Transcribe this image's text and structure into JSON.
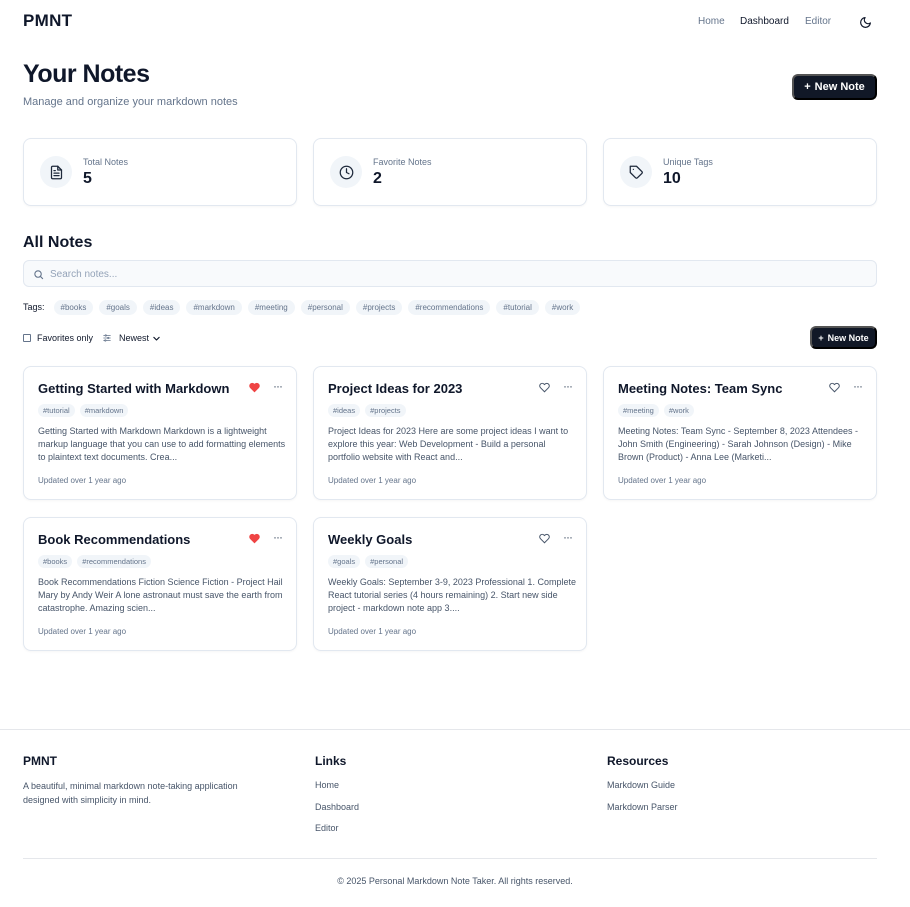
{
  "header": {
    "logo": "PMNT",
    "nav": [
      "Home",
      "Dashboard",
      "Editor"
    ]
  },
  "page": {
    "title": "Your Notes",
    "subtitle": "Manage and organize your markdown notes",
    "new_note_label": "New Note"
  },
  "stats": [
    {
      "label": "Total Notes",
      "value": "5",
      "icon": "file-text-icon"
    },
    {
      "label": "Favorite Notes",
      "value": "2",
      "icon": "clock-icon"
    },
    {
      "label": "Unique Tags",
      "value": "10",
      "icon": "tag-icon"
    }
  ],
  "all_notes": {
    "title": "All Notes",
    "search_placeholder": "Search notes...",
    "tags_label": "Tags:",
    "tags": [
      "#books",
      "#goals",
      "#ideas",
      "#markdown",
      "#meeting",
      "#personal",
      "#projects",
      "#recommendations",
      "#tutorial",
      "#work"
    ],
    "favorites_only_label": "Favorites only",
    "sort_label": "Newest",
    "new_note_label": "New Note"
  },
  "notes": [
    {
      "title": "Getting Started with Markdown",
      "favorite": true,
      "tags": [
        "#tutorial",
        "#markdown"
      ],
      "excerpt": "Getting Started with Markdown Markdown is a lightweight markup language that you can use to add formatting elements to plaintext text documents. Crea...",
      "updated": "Updated over 1 year ago"
    },
    {
      "title": "Project Ideas for 2023",
      "favorite": false,
      "tags": [
        "#ideas",
        "#projects"
      ],
      "excerpt": "Project Ideas for 2023 Here are some project ideas I want to explore this year: Web Development - Build a personal portfolio website with React and...",
      "updated": "Updated over 1 year ago"
    },
    {
      "title": "Meeting Notes: Team Sync",
      "favorite": false,
      "tags": [
        "#meeting",
        "#work"
      ],
      "excerpt": "Meeting Notes: Team Sync - September 8, 2023 Attendees - John Smith (Engineering) - Sarah Johnson (Design) - Mike Brown (Product) - Anna Lee (Marketi...",
      "updated": "Updated over 1 year ago"
    },
    {
      "title": "Book Recommendations",
      "favorite": true,
      "tags": [
        "#books",
        "#recommendations"
      ],
      "excerpt": "Book Recommendations Fiction Science Fiction - Project Hail Mary by Andy Weir A lone astronaut must save the earth from catastrophe. Amazing scien...",
      "updated": "Updated over 1 year ago"
    },
    {
      "title": "Weekly Goals",
      "favorite": false,
      "tags": [
        "#goals",
        "#personal"
      ],
      "excerpt": "Weekly Goals: September 3-9, 2023 Professional 1. Complete React tutorial series (4 hours remaining) 2. Start new side project - markdown note app 3....",
      "updated": "Updated over 1 year ago"
    }
  ],
  "footer": {
    "brand": "PMNT",
    "description": "A beautiful, minimal markdown note-taking application designed with simplicity in mind.",
    "links_title": "Links",
    "links": [
      "Home",
      "Dashboard",
      "Editor"
    ],
    "resources_title": "Resources",
    "resources": [
      "Markdown Guide",
      "Markdown Parser"
    ],
    "copyright": "© 2025 Personal Markdown Note Taker. All rights reserved."
  },
  "colors": {
    "primary_button": "#111827",
    "favorite_heart": "#ef4444",
    "border": "#e2e8f0",
    "muted_text": "#64748b"
  }
}
